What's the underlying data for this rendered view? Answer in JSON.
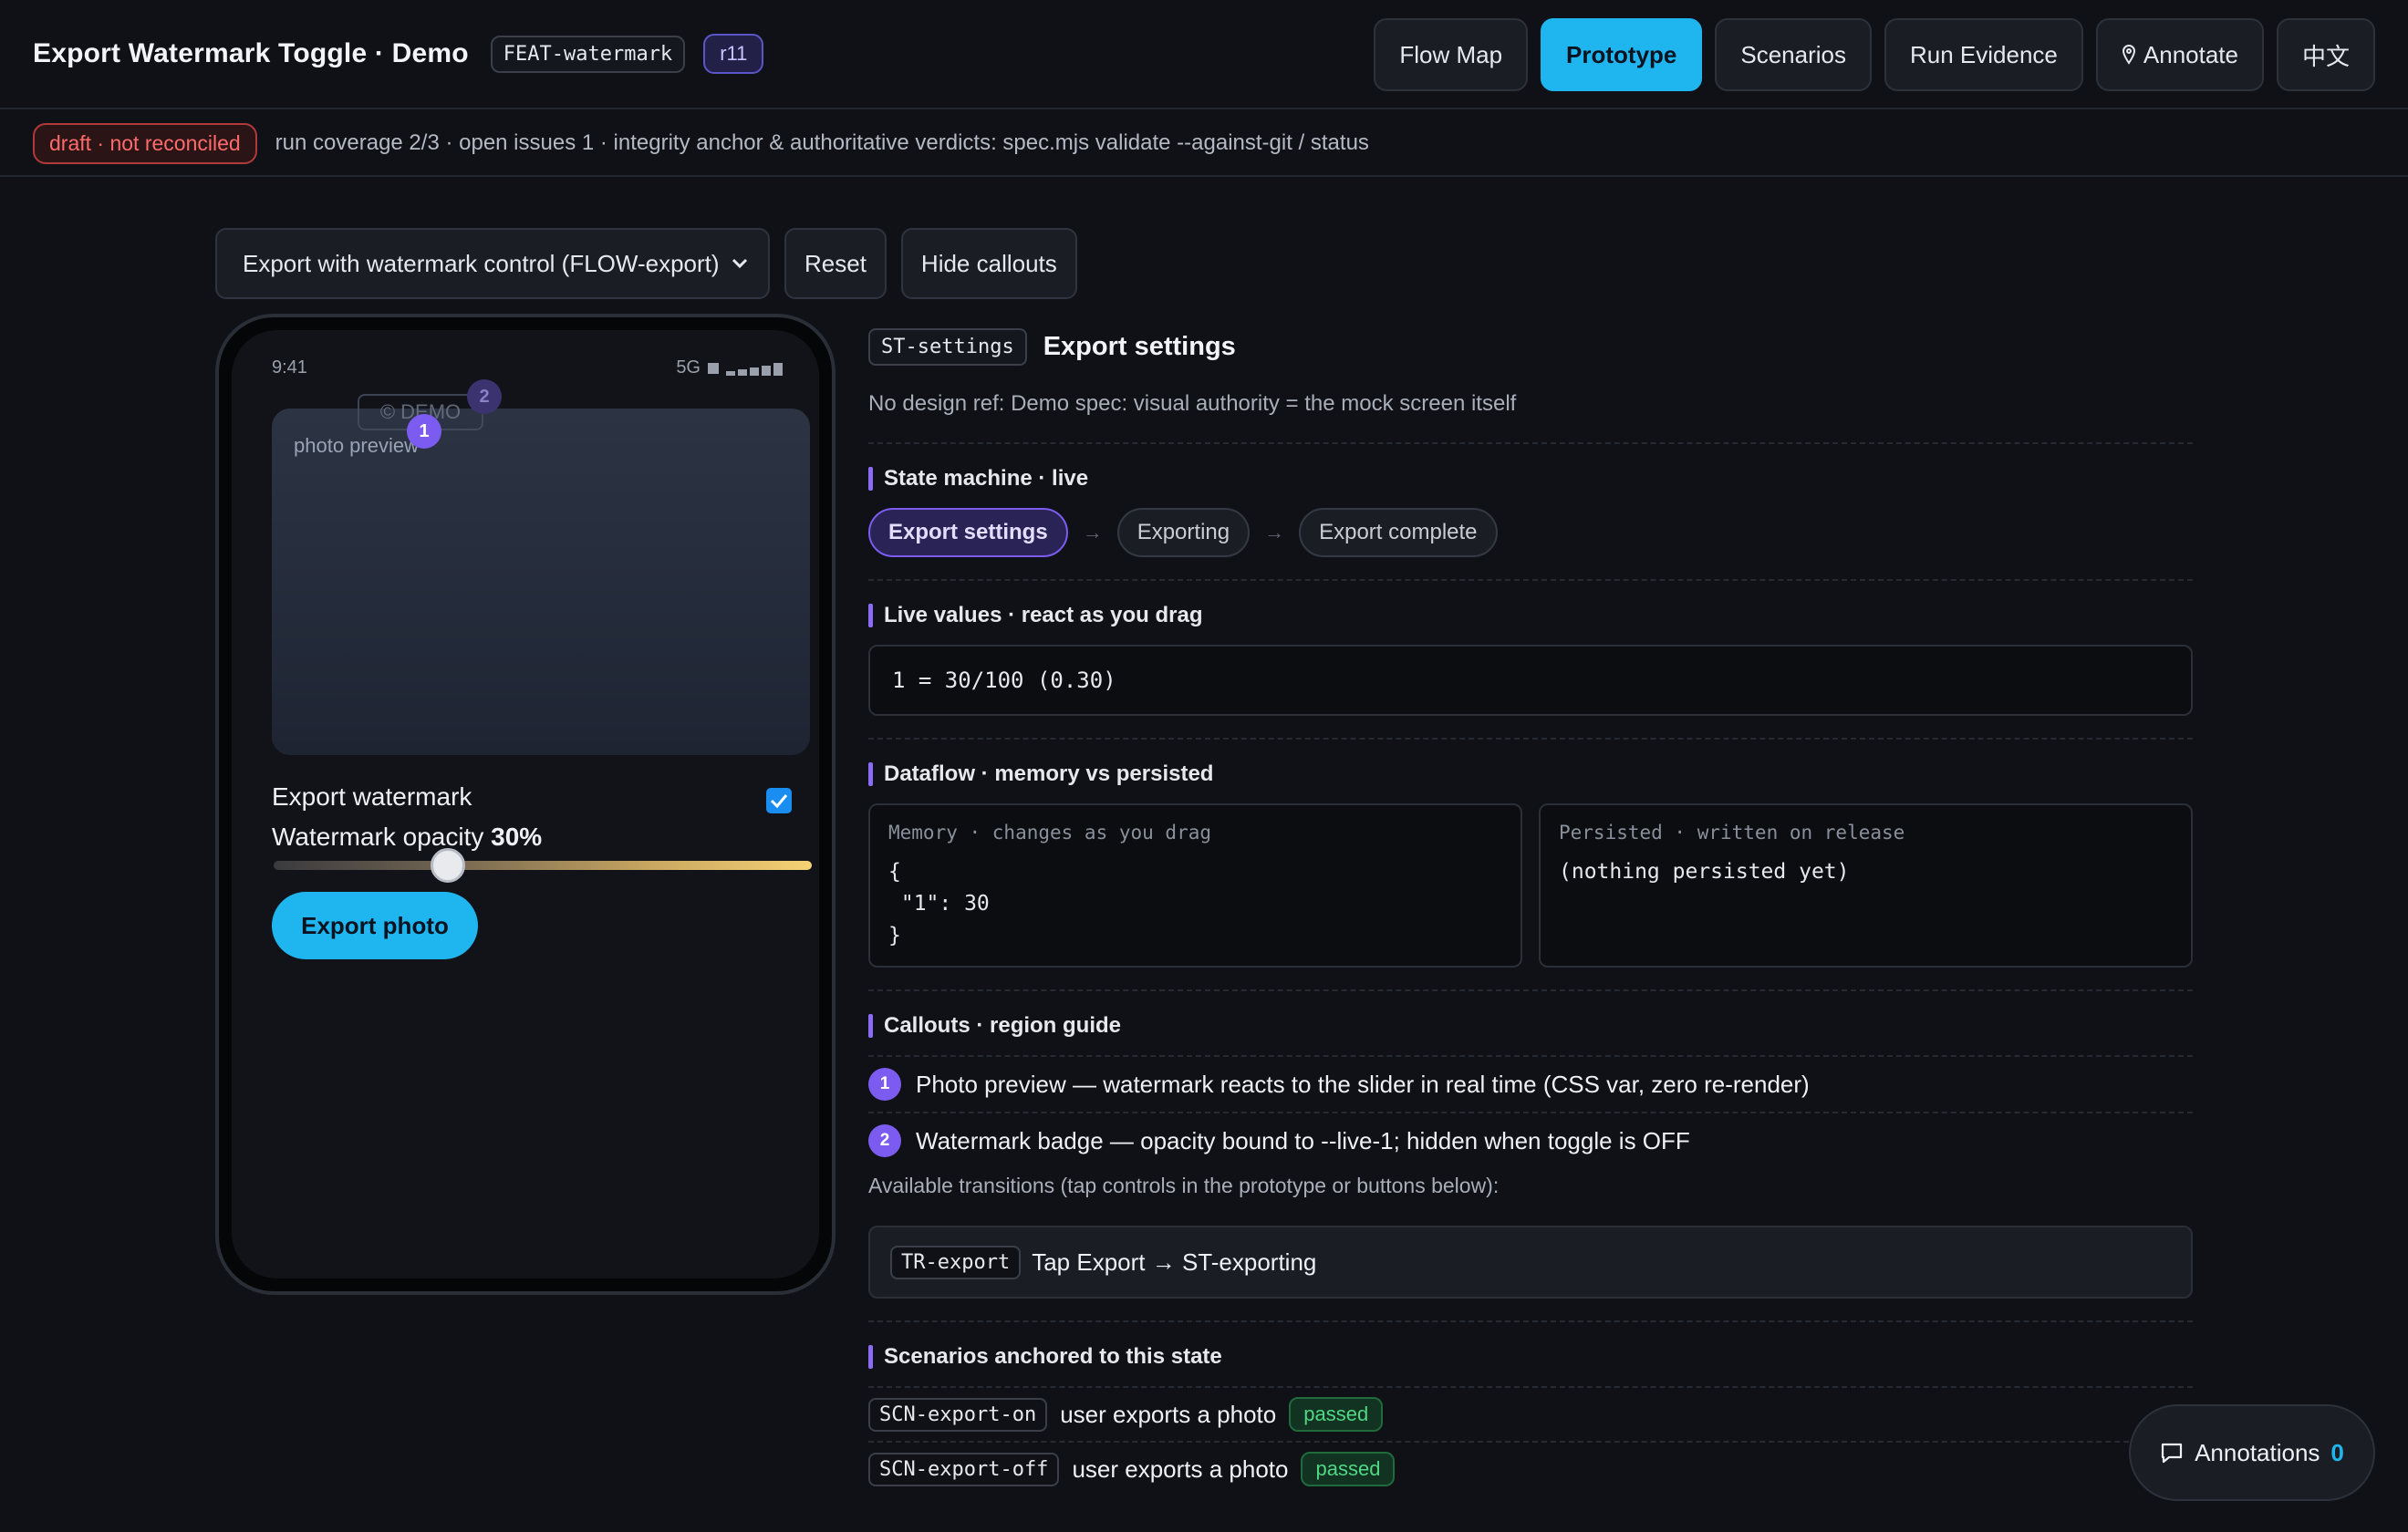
{
  "header": {
    "title": "Export Watermark Toggle · Demo",
    "feature": "FEAT-watermark",
    "revision": "r11",
    "nav": [
      "Flow Map",
      "Prototype",
      "Scenarios",
      "Run Evidence",
      "Annotate",
      "中文"
    ],
    "active_nav": "Prototype"
  },
  "status": {
    "badge": "draft · not reconciled",
    "text": "run coverage 2/3 · open issues 1 · integrity anchor & authoritative verdicts: spec.mjs validate --against-git / status"
  },
  "controls": {
    "flow_select": "Export with watermark control (FLOW-export)",
    "reset": "Reset",
    "hide_callouts": "Hide callouts"
  },
  "phone": {
    "time": "9:41",
    "network": "5G",
    "photo_label": "photo preview",
    "watermark_badge": "© DEMO",
    "callout_1": "1",
    "callout_2": "2",
    "toggle_label": "Export watermark",
    "toggle_checked": true,
    "opacity_label": "Watermark opacity",
    "opacity_value": "30%",
    "opacity_fraction": 0.3,
    "export_button": "Export photo"
  },
  "panel": {
    "state_id": "ST-settings",
    "state_title": "Export settings",
    "design_ref": "No design ref: Demo spec: visual authority = the mock screen itself",
    "state_machine_heading": "State machine · live",
    "states": [
      "Export settings",
      "Exporting",
      "Export complete"
    ],
    "active_state": "Export settings",
    "live_heading": "Live values · react as you drag",
    "live_value": "1 = 30/100 (0.30)",
    "dataflow_heading": "Dataflow · memory vs persisted",
    "memory_caption": "Memory · changes as you drag",
    "memory_code": "{\n \"1\": 30\n}",
    "persisted_caption": "Persisted · written on release",
    "persisted_code": "(nothing persisted yet)",
    "callouts_heading": "Callouts · region guide",
    "callouts": [
      {
        "num": "1",
        "text": "Photo preview — watermark reacts to the slider in real time (CSS var, zero re-render)"
      },
      {
        "num": "2",
        "text": "Watermark badge — opacity bound to --live-1; hidden when toggle is OFF"
      }
    ],
    "transitions_caption": "Available transitions (tap controls in the prototype or buttons below):",
    "transition": {
      "id": "TR-export",
      "text": "Tap Export → ST-exporting"
    },
    "scenarios_heading": "Scenarios anchored to this state",
    "scenarios": [
      {
        "id": "SCN-export-on",
        "text": "user exports a photo",
        "status": "passed"
      },
      {
        "id": "SCN-export-off",
        "text": "user exports a photo",
        "status": "passed"
      }
    ]
  },
  "annotations": {
    "label": "Annotations",
    "count": "0"
  }
}
